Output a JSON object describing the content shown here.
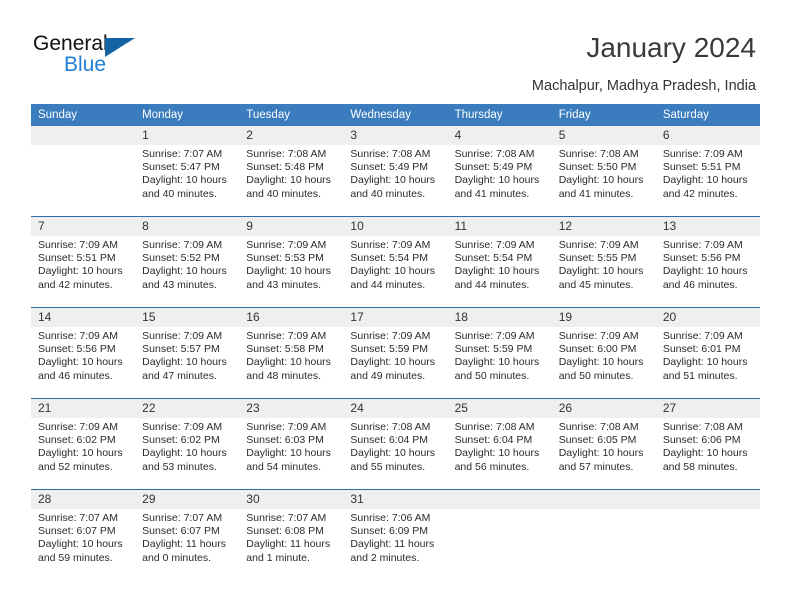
{
  "logo": {
    "word_one": "General",
    "word_two": "Blue",
    "triangle_color": "#1464a5",
    "blue_color": "#1e7fd4"
  },
  "header": {
    "title": "January 2024",
    "subtitle": "Machalpur, Madhya Pradesh, India"
  },
  "calendar": {
    "header_bg": "#3a7cbe",
    "weekdays": [
      "Sunday",
      "Monday",
      "Tuesday",
      "Wednesday",
      "Thursday",
      "Friday",
      "Saturday"
    ],
    "weeks": [
      {
        "days": [
          {
            "num": "",
            "sunrise": "",
            "sunset": "",
            "daylight1": "",
            "daylight2": "",
            "empty": true
          },
          {
            "num": "1",
            "sunrise": "Sunrise: 7:07 AM",
            "sunset": "Sunset: 5:47 PM",
            "daylight1": "Daylight: 10 hours",
            "daylight2": "and 40 minutes."
          },
          {
            "num": "2",
            "sunrise": "Sunrise: 7:08 AM",
            "sunset": "Sunset: 5:48 PM",
            "daylight1": "Daylight: 10 hours",
            "daylight2": "and 40 minutes."
          },
          {
            "num": "3",
            "sunrise": "Sunrise: 7:08 AM",
            "sunset": "Sunset: 5:49 PM",
            "daylight1": "Daylight: 10 hours",
            "daylight2": "and 40 minutes."
          },
          {
            "num": "4",
            "sunrise": "Sunrise: 7:08 AM",
            "sunset": "Sunset: 5:49 PM",
            "daylight1": "Daylight: 10 hours",
            "daylight2": "and 41 minutes."
          },
          {
            "num": "5",
            "sunrise": "Sunrise: 7:08 AM",
            "sunset": "Sunset: 5:50 PM",
            "daylight1": "Daylight: 10 hours",
            "daylight2": "and 41 minutes."
          },
          {
            "num": "6",
            "sunrise": "Sunrise: 7:09 AM",
            "sunset": "Sunset: 5:51 PM",
            "daylight1": "Daylight: 10 hours",
            "daylight2": "and 42 minutes."
          }
        ]
      },
      {
        "days": [
          {
            "num": "7",
            "sunrise": "Sunrise: 7:09 AM",
            "sunset": "Sunset: 5:51 PM",
            "daylight1": "Daylight: 10 hours",
            "daylight2": "and 42 minutes."
          },
          {
            "num": "8",
            "sunrise": "Sunrise: 7:09 AM",
            "sunset": "Sunset: 5:52 PM",
            "daylight1": "Daylight: 10 hours",
            "daylight2": "and 43 minutes."
          },
          {
            "num": "9",
            "sunrise": "Sunrise: 7:09 AM",
            "sunset": "Sunset: 5:53 PM",
            "daylight1": "Daylight: 10 hours",
            "daylight2": "and 43 minutes."
          },
          {
            "num": "10",
            "sunrise": "Sunrise: 7:09 AM",
            "sunset": "Sunset: 5:54 PM",
            "daylight1": "Daylight: 10 hours",
            "daylight2": "and 44 minutes."
          },
          {
            "num": "11",
            "sunrise": "Sunrise: 7:09 AM",
            "sunset": "Sunset: 5:54 PM",
            "daylight1": "Daylight: 10 hours",
            "daylight2": "and 44 minutes."
          },
          {
            "num": "12",
            "sunrise": "Sunrise: 7:09 AM",
            "sunset": "Sunset: 5:55 PM",
            "daylight1": "Daylight: 10 hours",
            "daylight2": "and 45 minutes."
          },
          {
            "num": "13",
            "sunrise": "Sunrise: 7:09 AM",
            "sunset": "Sunset: 5:56 PM",
            "daylight1": "Daylight: 10 hours",
            "daylight2": "and 46 minutes."
          }
        ]
      },
      {
        "days": [
          {
            "num": "14",
            "sunrise": "Sunrise: 7:09 AM",
            "sunset": "Sunset: 5:56 PM",
            "daylight1": "Daylight: 10 hours",
            "daylight2": "and 46 minutes."
          },
          {
            "num": "15",
            "sunrise": "Sunrise: 7:09 AM",
            "sunset": "Sunset: 5:57 PM",
            "daylight1": "Daylight: 10 hours",
            "daylight2": "and 47 minutes."
          },
          {
            "num": "16",
            "sunrise": "Sunrise: 7:09 AM",
            "sunset": "Sunset: 5:58 PM",
            "daylight1": "Daylight: 10 hours",
            "daylight2": "and 48 minutes."
          },
          {
            "num": "17",
            "sunrise": "Sunrise: 7:09 AM",
            "sunset": "Sunset: 5:59 PM",
            "daylight1": "Daylight: 10 hours",
            "daylight2": "and 49 minutes."
          },
          {
            "num": "18",
            "sunrise": "Sunrise: 7:09 AM",
            "sunset": "Sunset: 5:59 PM",
            "daylight1": "Daylight: 10 hours",
            "daylight2": "and 50 minutes."
          },
          {
            "num": "19",
            "sunrise": "Sunrise: 7:09 AM",
            "sunset": "Sunset: 6:00 PM",
            "daylight1": "Daylight: 10 hours",
            "daylight2": "and 50 minutes."
          },
          {
            "num": "20",
            "sunrise": "Sunrise: 7:09 AM",
            "sunset": "Sunset: 6:01 PM",
            "daylight1": "Daylight: 10 hours",
            "daylight2": "and 51 minutes."
          }
        ]
      },
      {
        "days": [
          {
            "num": "21",
            "sunrise": "Sunrise: 7:09 AM",
            "sunset": "Sunset: 6:02 PM",
            "daylight1": "Daylight: 10 hours",
            "daylight2": "and 52 minutes."
          },
          {
            "num": "22",
            "sunrise": "Sunrise: 7:09 AM",
            "sunset": "Sunset: 6:02 PM",
            "daylight1": "Daylight: 10 hours",
            "daylight2": "and 53 minutes."
          },
          {
            "num": "23",
            "sunrise": "Sunrise: 7:09 AM",
            "sunset": "Sunset: 6:03 PM",
            "daylight1": "Daylight: 10 hours",
            "daylight2": "and 54 minutes."
          },
          {
            "num": "24",
            "sunrise": "Sunrise: 7:08 AM",
            "sunset": "Sunset: 6:04 PM",
            "daylight1": "Daylight: 10 hours",
            "daylight2": "and 55 minutes."
          },
          {
            "num": "25",
            "sunrise": "Sunrise: 7:08 AM",
            "sunset": "Sunset: 6:04 PM",
            "daylight1": "Daylight: 10 hours",
            "daylight2": "and 56 minutes."
          },
          {
            "num": "26",
            "sunrise": "Sunrise: 7:08 AM",
            "sunset": "Sunset: 6:05 PM",
            "daylight1": "Daylight: 10 hours",
            "daylight2": "and 57 minutes."
          },
          {
            "num": "27",
            "sunrise": "Sunrise: 7:08 AM",
            "sunset": "Sunset: 6:06 PM",
            "daylight1": "Daylight: 10 hours",
            "daylight2": "and 58 minutes."
          }
        ]
      },
      {
        "days": [
          {
            "num": "28",
            "sunrise": "Sunrise: 7:07 AM",
            "sunset": "Sunset: 6:07 PM",
            "daylight1": "Daylight: 10 hours",
            "daylight2": "and 59 minutes."
          },
          {
            "num": "29",
            "sunrise": "Sunrise: 7:07 AM",
            "sunset": "Sunset: 6:07 PM",
            "daylight1": "Daylight: 11 hours",
            "daylight2": "and 0 minutes."
          },
          {
            "num": "30",
            "sunrise": "Sunrise: 7:07 AM",
            "sunset": "Sunset: 6:08 PM",
            "daylight1": "Daylight: 11 hours",
            "daylight2": "and 1 minute."
          },
          {
            "num": "31",
            "sunrise": "Sunrise: 7:06 AM",
            "sunset": "Sunset: 6:09 PM",
            "daylight1": "Daylight: 11 hours",
            "daylight2": "and 2 minutes."
          },
          {
            "num": "",
            "sunrise": "",
            "sunset": "",
            "daylight1": "",
            "daylight2": "",
            "empty": true
          },
          {
            "num": "",
            "sunrise": "",
            "sunset": "",
            "daylight1": "",
            "daylight2": "",
            "empty": true
          },
          {
            "num": "",
            "sunrise": "",
            "sunset": "",
            "daylight1": "",
            "daylight2": "",
            "empty": true
          }
        ]
      }
    ]
  }
}
